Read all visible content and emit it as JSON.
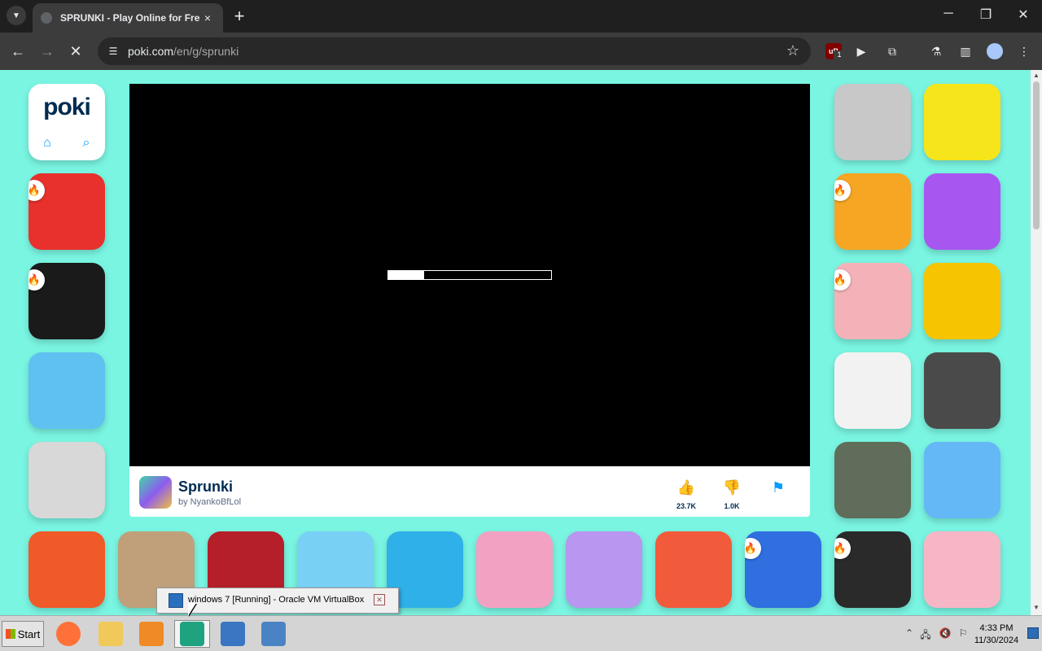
{
  "browser": {
    "tab": {
      "title": "SPRUNKI - Play Online for Free",
      "close": "×"
    },
    "new_tab": "+",
    "window_controls": {
      "minimize": "─",
      "maximize": "❐",
      "close": "✕"
    },
    "nav": {
      "back": "←",
      "forward": "→",
      "reload": "✕"
    },
    "url": {
      "domain": "poki.com",
      "path": "/en/g/sprunki"
    },
    "extensions": {
      "ublock_count": "1"
    }
  },
  "site": {
    "logo": "poki",
    "home_icon": "⌂",
    "search_icon": "⌕",
    "hot_badge": "🔥"
  },
  "left_tiles": [
    {
      "hot": true,
      "color": "#e8302c"
    },
    {
      "hot": true,
      "color": "#1a1a1a"
    },
    {
      "hot": false,
      "color": "#5fc1f0"
    },
    {
      "hot": false,
      "color": "#d8d8d8"
    }
  ],
  "right_tiles": [
    {
      "hot": false,
      "color": "#c8c8c8"
    },
    {
      "hot": false,
      "color": "#f7e51b"
    },
    {
      "hot": true,
      "color": "#f6a623"
    },
    {
      "hot": false,
      "color": "#a856f0"
    },
    {
      "hot": true,
      "color": "#f4b2b8"
    },
    {
      "hot": false,
      "color": "#f6c400"
    },
    {
      "hot": false,
      "color": "#f2f2f2"
    },
    {
      "hot": false,
      "color": "#4a4a4a"
    },
    {
      "hot": false,
      "color": "#5f6d5a"
    },
    {
      "hot": false,
      "color": "#63b8f5"
    }
  ],
  "bottom_tiles": [
    {
      "hot": false,
      "color": "#f05a28"
    },
    {
      "hot": false,
      "color": "#bfa07a"
    },
    {
      "hot": false,
      "color": "#b51f2a"
    },
    {
      "hot": false,
      "color": "#78d0f5"
    },
    {
      "hot": false,
      "color": "#2fb0e8"
    },
    {
      "hot": false,
      "color": "#f3a1c2"
    },
    {
      "hot": false,
      "color": "#b996f0"
    },
    {
      "hot": false,
      "color": "#f25a3c"
    },
    {
      "hot": true,
      "color": "#2f6fe0"
    },
    {
      "hot": true,
      "color": "#2a2a2a"
    },
    {
      "hot": false,
      "color": "#f7b6c6"
    }
  ],
  "game": {
    "title": "Sprunki",
    "author": "by NyankoBfLol",
    "loading_progress": 0.22,
    "like_icon": "👍",
    "dislike_icon": "👎",
    "report_icon": "⚑",
    "likes": "23.7K",
    "dislikes": "1.0K"
  },
  "vbox_tooltip": {
    "text": "windows 7  [Running] - Oracle VM VirtualBox",
    "close": "✕"
  },
  "taskbar": {
    "start_label": "Start",
    "apps": [
      {
        "name": "firefox",
        "color": "#ff7139"
      },
      {
        "name": "explorer",
        "color": "#f0c95a"
      },
      {
        "name": "media-player",
        "color": "#f08a24"
      },
      {
        "name": "browser",
        "color": "#1fa27f"
      },
      {
        "name": "virtualbox",
        "color": "#3a76c2"
      },
      {
        "name": "windows7",
        "color": "#4a83c4"
      }
    ],
    "tray": {
      "up": "⌃",
      "network": "🖧",
      "volume": "🔇",
      "flag": "⚐"
    },
    "time": "4:33 PM",
    "date": "11/30/2024"
  },
  "colors": {
    "page_bg": "#7af5e2",
    "poki_blue": "#009cff",
    "poki_navy": "#002b50"
  }
}
